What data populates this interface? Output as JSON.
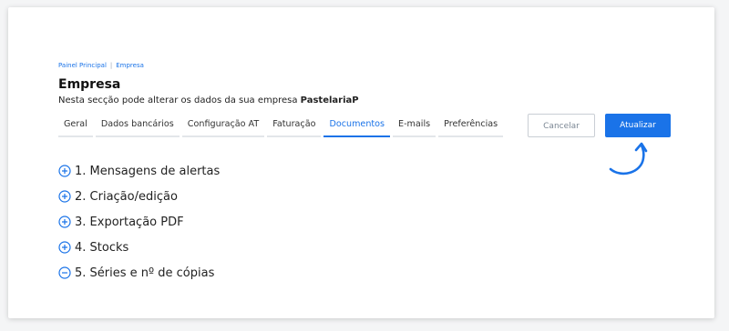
{
  "breadcrumb": {
    "items": [
      "Painel Principal",
      "Empresa"
    ],
    "separator": "|"
  },
  "header": {
    "title": "Empresa",
    "subtitle_prefix": "Nesta secção pode alterar os dados da sua empresa ",
    "company_name": "PastelariaP"
  },
  "tabs": [
    {
      "label": "Geral"
    },
    {
      "label": "Dados bancários"
    },
    {
      "label": "Configuração AT"
    },
    {
      "label": "Faturação"
    },
    {
      "label": "Documentos",
      "active": true
    },
    {
      "label": "E-mails"
    },
    {
      "label": "Preferências"
    }
  ],
  "actions": {
    "cancel_label": "Cancelar",
    "update_label": "Atualizar"
  },
  "sections": [
    {
      "label": "1. Mensagens de alertas",
      "icon": "plus-circle-icon",
      "expanded": false
    },
    {
      "label": "2. Criação/edição",
      "icon": "plus-circle-icon",
      "expanded": false
    },
    {
      "label": "3. Exportação PDF",
      "icon": "plus-circle-icon",
      "expanded": false
    },
    {
      "label": "4. Stocks",
      "icon": "plus-circle-icon",
      "expanded": false
    },
    {
      "label": "5. Séries e nº de cópias",
      "icon": "minus-circle-icon",
      "expanded": true
    }
  ],
  "colors": {
    "accent": "#1a73e8",
    "text": "#222222",
    "border": "#c9ced4"
  }
}
